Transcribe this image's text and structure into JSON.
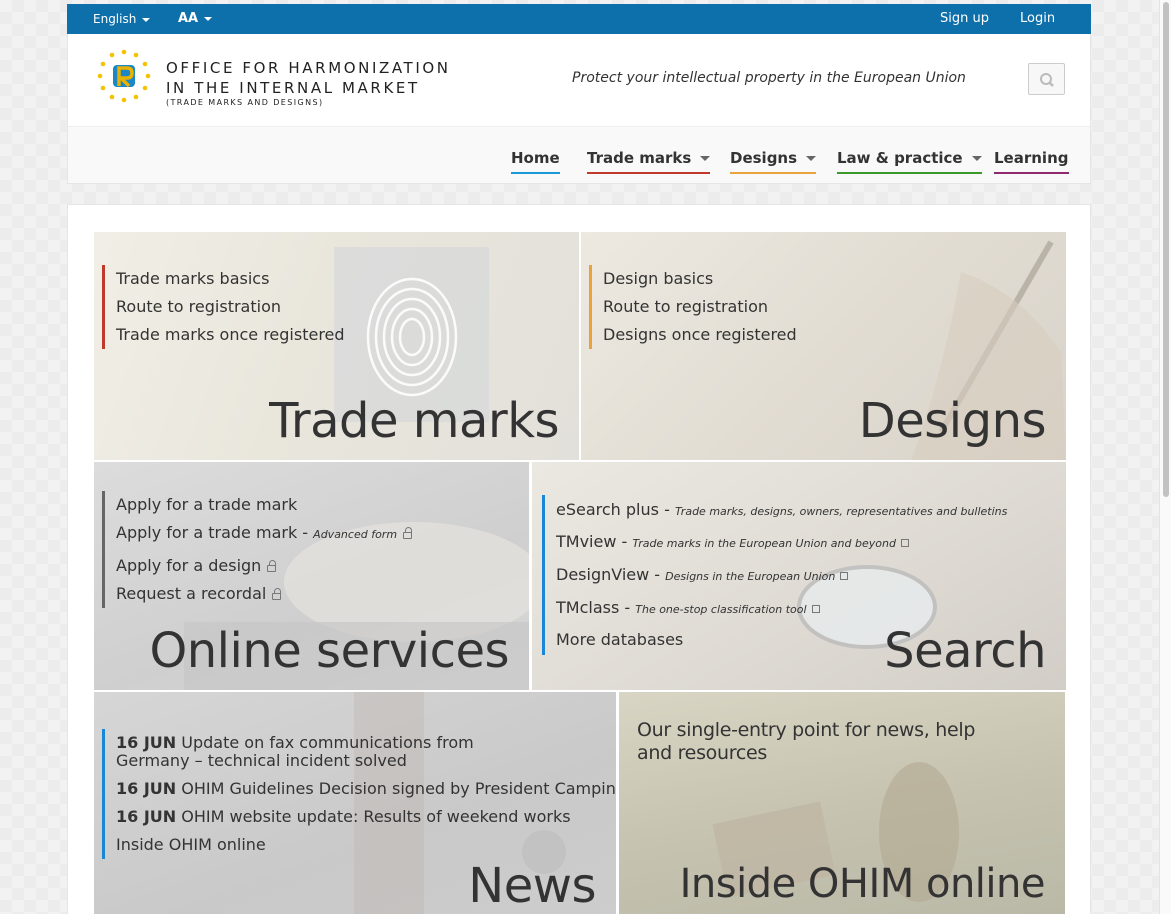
{
  "topbar": {
    "language": "English",
    "font_size_label": "AA",
    "signup": "Sign up",
    "login": "Login"
  },
  "header": {
    "logo_line1": "OFFICE FOR HARMONIZATION",
    "logo_line2": "IN THE INTERNAL MARKET",
    "logo_line3": "(TRADE MARKS AND DESIGNS)",
    "tagline": "Protect your intellectual property in the European Union"
  },
  "nav": {
    "items": [
      {
        "label": "Home",
        "color": "#1a9ad6"
      },
      {
        "label": "Trade marks",
        "color": "#c0392b"
      },
      {
        "label": "Designs",
        "color": "#e8a33d"
      },
      {
        "label": "Law & practice",
        "color": "#3c9a2a"
      },
      {
        "label": "Learning",
        "color": "#8e2b6e"
      }
    ]
  },
  "tiles": {
    "trademarks": {
      "title": "Trade marks",
      "links": [
        "Trade marks basics",
        "Route to registration",
        "Trade marks once registered"
      ],
      "accent": "#c0392b"
    },
    "designs": {
      "title": "Designs",
      "links": [
        "Design basics",
        "Route to registration",
        "Designs once registered"
      ],
      "accent": "#e8a33d"
    },
    "online": {
      "title": "Online services",
      "links": [
        "Apply for a trade mark",
        "Apply for a trade mark",
        "Apply for a design",
        "Request a recordal"
      ],
      "advanced_form": "Advanced form",
      "accent": "#666666"
    },
    "search": {
      "title": "Search",
      "items": [
        {
          "name": "eSearch plus",
          "desc": "Trade marks, designs, owners, representatives and bulletins"
        },
        {
          "name": "TMview",
          "desc": "Trade marks in the European Union and beyond"
        },
        {
          "name": "DesignView",
          "desc": "Designs in the European Union"
        },
        {
          "name": "TMclass",
          "desc": "The one-stop classification tool"
        }
      ],
      "more": "More databases",
      "accent": "#1a86d6"
    },
    "news": {
      "title": "News",
      "items": [
        {
          "date": "16 JUN",
          "text": "Update on fax communications from Germany – technical incident solved"
        },
        {
          "date": "16 JUN",
          "text": "OHIM Guidelines Decision signed by President Campinos"
        },
        {
          "date": "16 JUN",
          "text": "OHIM website update: Results of weekend works"
        }
      ],
      "inside": "Inside OHIM online",
      "accent": "#1a86d6"
    },
    "inside": {
      "title": "Inside OHIM online",
      "subtitle": "Our single-entry point for news, help and resources"
    }
  }
}
